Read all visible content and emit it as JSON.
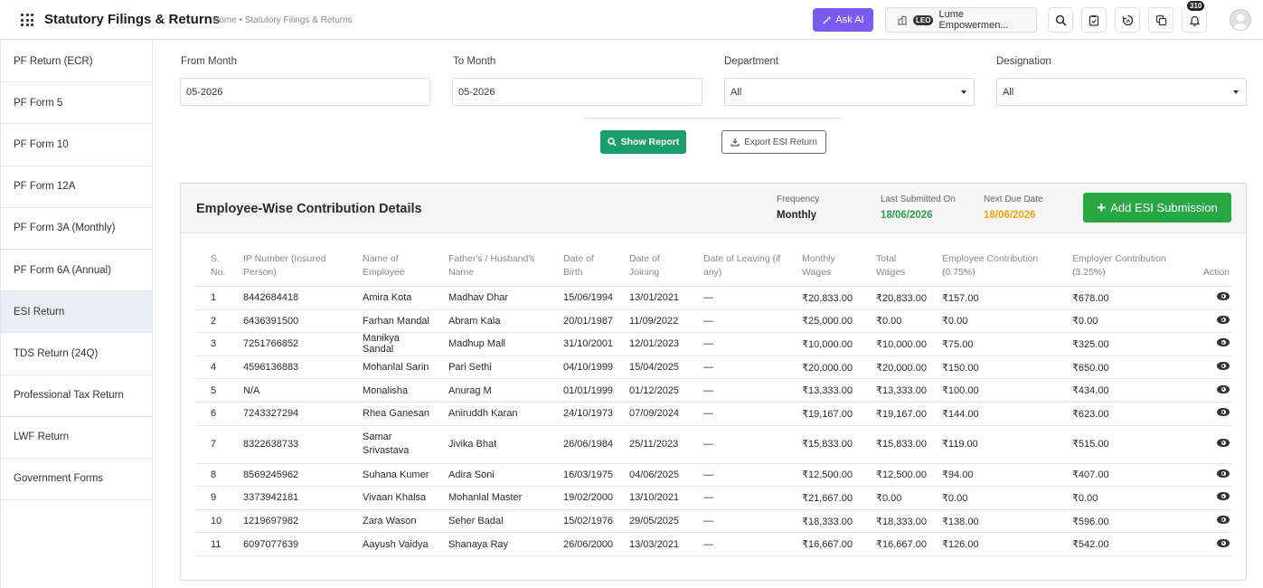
{
  "header": {
    "title": "Statutory Filings & Returns",
    "breadcrumb": "Home • Statutory Filings & Returns",
    "ask_ai": "Ask AI",
    "org_badge": "LEO",
    "org_name": "Lume Empowermen...",
    "notification_count": "310"
  },
  "sidebar": {
    "items": [
      {
        "label": "PF Return (ECR)"
      },
      {
        "label": "PF Form 5"
      },
      {
        "label": "PF Form 10"
      },
      {
        "label": "PF Form 12A"
      },
      {
        "label": "PF Form 3A (Monthly)"
      },
      {
        "label": "PF Form 6A (Annual)"
      },
      {
        "label": "ESI Return"
      },
      {
        "label": "TDS Return (24Q)"
      },
      {
        "label": "Professional Tax Return"
      },
      {
        "label": "LWF Return"
      },
      {
        "label": "Government Forms"
      }
    ],
    "active": "ESI Return"
  },
  "filters": {
    "from_month_label": "From Month",
    "from_month_value": "05-2026",
    "to_month_label": "To Month",
    "to_month_value": "05-2026",
    "department_label": "Department",
    "department_value": "All",
    "designation_label": "Designation",
    "designation_value": "All",
    "show_report": "Show Report",
    "export": "Export ESI Return"
  },
  "card": {
    "title": "Employee-Wise Contribution Details",
    "frequency_label": "Frequency",
    "frequency_value": "Monthly",
    "last_submitted_label": "Last Submitted On",
    "last_submitted_value": "18/06/2026",
    "next_due_label": "Next Due Date",
    "next_due_value": "18/06/2026",
    "add_button": "Add ESI Submission",
    "colors": {
      "last_submitted": "#2e9b4e",
      "next_due": "#f0a818",
      "add": "#28a745"
    }
  },
  "table": {
    "headers": [
      "S. No.",
      "IP Number (Insured Person)",
      "Name of Employee",
      "Father's / Husband's Name",
      "Date of Birth",
      "Date of Joining",
      "Date of Leaving (if any)",
      "Monthly Wages",
      "Total Wages",
      "Employee Contribution (0.75%)",
      "Employer Contribution (3.25%)",
      "Action"
    ],
    "rows": [
      [
        "1",
        "8442684418",
        "Amira Kota",
        "Madhav Dhar",
        "15/06/1994",
        "13/01/2021",
        "—",
        "₹20,833.00",
        "₹20,833.00",
        "₹157.00",
        "₹678.00"
      ],
      [
        "2",
        "6436391500",
        "Farhan Mandal",
        "Abram Kala",
        "20/01/1987",
        "11/09/2022",
        "—",
        "₹25,000.00",
        "₹0.00",
        "₹0.00",
        "₹0.00"
      ],
      [
        "3",
        "7251766852",
        "Manikya Sandal",
        "Madhup Mall",
        "31/10/2001",
        "12/01/2023",
        "—",
        "₹10,000.00",
        "₹10,000.00",
        "₹75.00",
        "₹325.00"
      ],
      [
        "4",
        "4596136883",
        "Mohanlal Sarin",
        "Pari Sethi",
        "04/10/1999",
        "15/04/2025",
        "—",
        "₹20,000.00",
        "₹20,000.00",
        "₹150.00",
        "₹650.00"
      ],
      [
        "5",
        "N/A",
        "Monalisha",
        "Anurag M",
        "01/01/1999",
        "01/12/2025",
        "—",
        "₹13,333.00",
        "₹13,333.00",
        "₹100.00",
        "₹434.00"
      ],
      [
        "6",
        "7243327294",
        "Rhea Ganesan",
        "Aniruddh Karan",
        "24/10/1973",
        "07/09/2024",
        "—",
        "₹19,167.00",
        "₹19,167.00",
        "₹144.00",
        "₹623.00"
      ],
      [
        "7",
        "8322638733",
        "Samar Srivastava",
        "Jivika Bhat",
        "26/06/1984",
        "25/11/2023",
        "—",
        "₹15,833.00",
        "₹15,833.00",
        "₹119.00",
        "₹515.00"
      ],
      [
        "8",
        "8569245962",
        "Suhana Kumer",
        "Adira Soni",
        "16/03/1975",
        "04/06/2025",
        "—",
        "₹12,500.00",
        "₹12,500.00",
        "₹94.00",
        "₹407.00"
      ],
      [
        "9",
        "3373942181",
        "Vivaan Khalsa",
        "Mohanlal Master",
        "19/02/2000",
        "13/10/2021",
        "—",
        "₹21,667.00",
        "₹0.00",
        "₹0.00",
        "₹0.00"
      ],
      [
        "10",
        "1219697982",
        "Zara Wason",
        "Seher Badal",
        "15/02/1976",
        "29/05/2025",
        "—",
        "₹18,333.00",
        "₹18,333.00",
        "₹138.00",
        "₹596.00"
      ],
      [
        "11",
        "6097077639",
        "Aayush Vaidya",
        "Shanaya Ray",
        "26/06/2000",
        "13/03/2021",
        "—",
        "₹16,667.00",
        "₹16,667.00",
        "₹126.00",
        "₹542.00"
      ]
    ]
  }
}
